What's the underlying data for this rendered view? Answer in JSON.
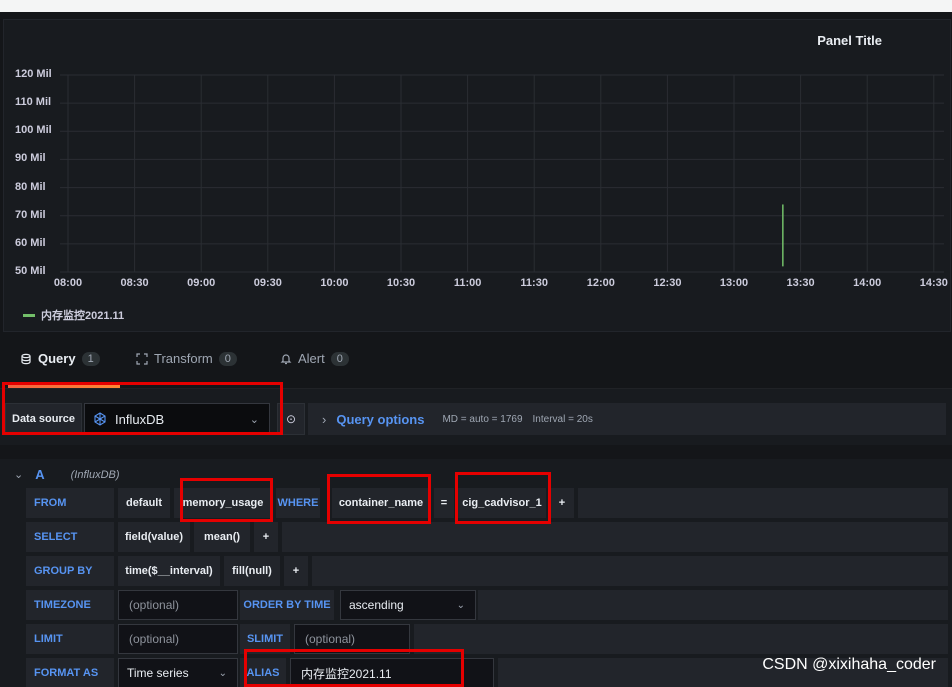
{
  "panel": {
    "title": "Panel Title"
  },
  "chart_data": {
    "type": "line",
    "title": "Panel Title",
    "y_ticks": [
      "120 Mil",
      "110 Mil",
      "100 Mil",
      "90 Mil",
      "80 Mil",
      "70 Mil",
      "60 Mil",
      "50 Mil"
    ],
    "x_ticks": [
      "08:00",
      "08:30",
      "09:00",
      "09:30",
      "10:00",
      "10:30",
      "11:00",
      "11:30",
      "12:00",
      "12:30",
      "13:00",
      "13:30",
      "14:00",
      "14:30"
    ],
    "ylim_mil": [
      50,
      120
    ],
    "grid": true,
    "legend_placement": "bottom-left",
    "series": [
      {
        "name": "内存监控2021.11",
        "color": "#73bf69",
        "points": [
          {
            "x": "13:22",
            "y_mil": 52
          },
          {
            "x": "13:22",
            "y_mil": 74
          }
        ]
      }
    ]
  },
  "tabs": [
    {
      "label": "Query",
      "count": "1",
      "icon": "database-icon"
    },
    {
      "label": "Transform",
      "count": "0",
      "icon": "transform-icon"
    },
    {
      "label": "Alert",
      "count": "0",
      "icon": "bell-icon"
    }
  ],
  "datasource": {
    "label": "Data source",
    "name": "InfluxDB",
    "chevron": "⌄",
    "info_icon": "⊙",
    "query_options_arrow": "›",
    "query_options": "Query options",
    "md": "MD = auto = 1769",
    "interval": "Interval = 20s"
  },
  "query": {
    "collapse": "⌄",
    "letter": "A",
    "ds": "(InfluxDB)",
    "from_kw": "FROM",
    "policy": "default",
    "measurement": "memory_usage",
    "where_kw": "WHERE",
    "tag_key": "container_name",
    "operator": "=",
    "tag_value": "cig_cadvisor_1",
    "plus": "+",
    "select_kw": "SELECT",
    "field": "field(value)",
    "agg": "mean()",
    "groupby_kw": "GROUP BY",
    "time_interval": "time($__interval)",
    "fill": "fill(null)",
    "timezone_kw": "TIMEZONE",
    "optional": "(optional)",
    "orderby_kw": "ORDER BY TIME",
    "order": "ascending",
    "limit_kw": "LIMIT",
    "slimit_kw": "SLIMIT",
    "format_kw": "FORMAT AS",
    "format": "Time series",
    "alias_kw": "ALIAS",
    "alias": "内存监控2021.11"
  },
  "watermark": "CSDN @xixihaha_coder"
}
